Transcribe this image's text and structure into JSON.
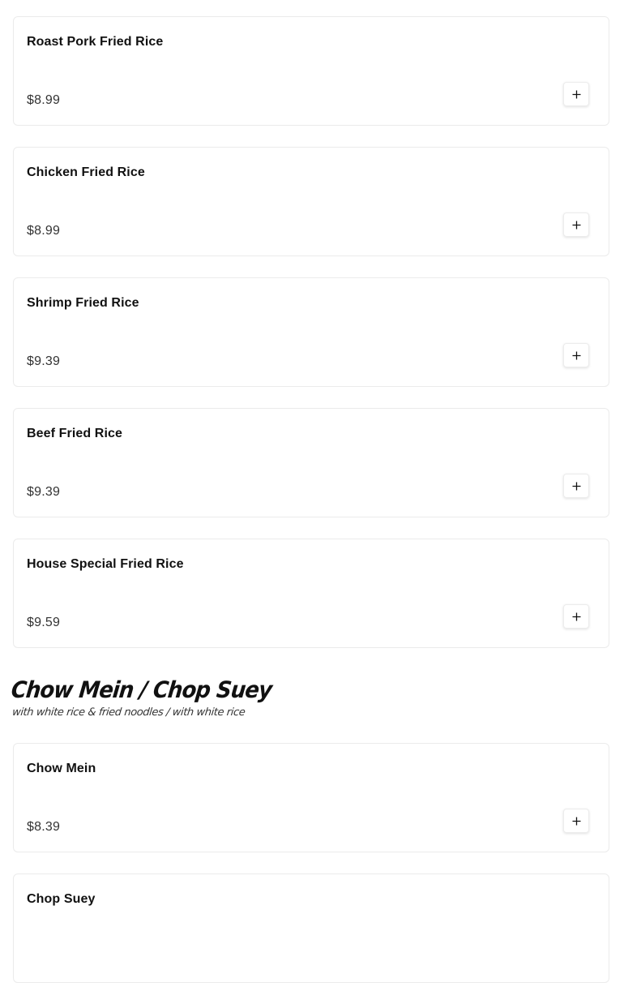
{
  "sections": [
    {
      "items": [
        {
          "name": "Roast Pork Fried Rice",
          "price": "$8.99"
        },
        {
          "name": "Chicken Fried Rice",
          "price": "$8.99"
        },
        {
          "name": "Shrimp Fried Rice",
          "price": "$9.39"
        },
        {
          "name": "Beef Fried Rice",
          "price": "$9.39"
        },
        {
          "name": "House Special Fried Rice",
          "price": "$9.59"
        }
      ]
    },
    {
      "title": "Chow Mein / Chop Suey",
      "subtitle": "with white rice & fried noodles / with white rice",
      "items": [
        {
          "name": "Chow Mein",
          "price": "$8.39"
        },
        {
          "name": "Chop Suey",
          "price": ""
        }
      ]
    }
  ],
  "icons": {
    "add": "plus-icon"
  },
  "colors": {
    "card_border": "#ebebeb",
    "text": "#111111",
    "price_text": "#333333"
  }
}
